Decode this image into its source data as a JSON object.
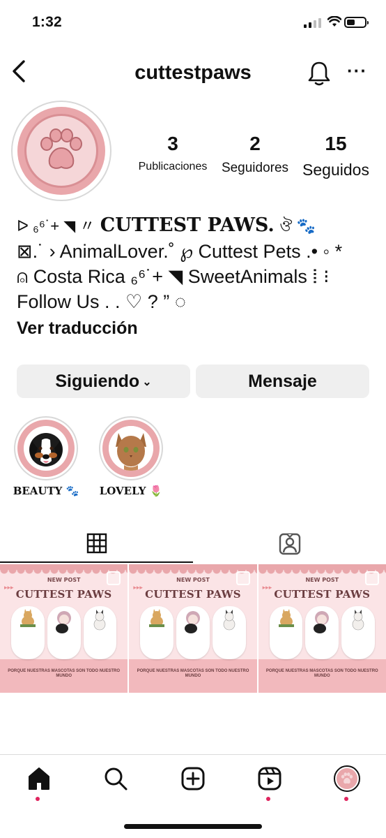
{
  "status_bar": {
    "time": "1:32"
  },
  "header": {
    "username": "cuttestpaws"
  },
  "profile": {
    "stats": [
      {
        "value": "3",
        "label": "Publicaciones"
      },
      {
        "value": "2",
        "label": "Seguidores"
      },
      {
        "value": "15",
        "label": "Seguidos"
      }
    ],
    "bio": {
      "line1_prefix": "ᐅ ₆⁶˙+ ◥ 〃",
      "line1_title": "CUTTEST PAWS.",
      "line1_suffix": "ঔ 🐾",
      "line2": "⊠.˙ › AnimalLover.˚ ℘ Cuttest Pets .• ◦ *",
      "line3": "⍝ Costa Rica ₆⁶˙+ ◥ SweetAnimals ⵂ  ⁝",
      "line4": "Follow Us . . ♡  ? ” ◌"
    },
    "translate_label": "Ver traducción"
  },
  "buttons": {
    "following_label": "Siguiendo",
    "message_label": "Mensaje"
  },
  "highlights": [
    {
      "label": "BEAUTY 🐾"
    },
    {
      "label": "LOVELY 🌷"
    }
  ],
  "posts": [
    {
      "badge": "NEW POST",
      "title": "CUTTEST PAWS",
      "caption": "PORQUE NUESTRAS MASCOTAS SON TODO NUESTRO MUNDO"
    },
    {
      "badge": "NEW POST",
      "title": "CUTTEST PAWS",
      "caption": "PORQUE NUESTRAS MASCOTAS SON TODO NUESTRO MUNDO"
    },
    {
      "badge": "NEW POST",
      "title": "CUTTEST PAWS",
      "caption": "PORQUE NUESTRAS MASCOTAS SON TODO NUESTRO MUNDO"
    }
  ],
  "colors": {
    "accent_pink": "#e9a7ab",
    "notification_dot": "#e0245e",
    "button_bg": "#efefef"
  },
  "icons": [
    "back-icon",
    "bell-icon",
    "more-icon",
    "grid-icon",
    "tagged-icon",
    "home-icon",
    "search-icon",
    "add-icon",
    "reels-icon"
  ]
}
